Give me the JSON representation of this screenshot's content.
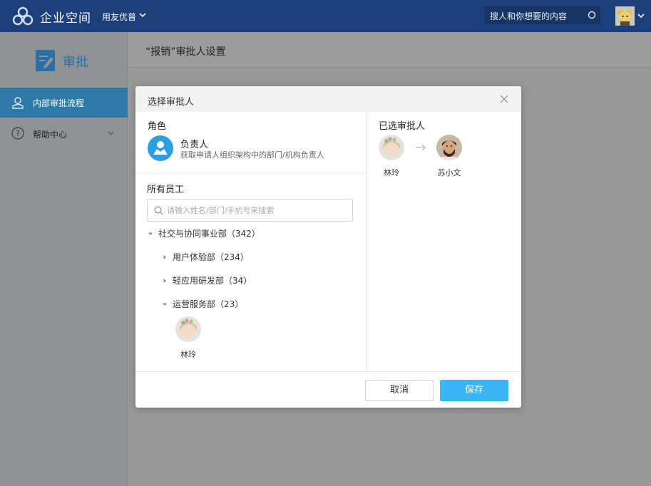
{
  "topbar": {
    "brand": "企业空间",
    "org": "用友优普",
    "search_placeholder": "搜人和你想要的内容",
    "bg_color": "#1b3f7a"
  },
  "sidebar": {
    "title": "审批",
    "items": [
      {
        "label": "内部审批流程",
        "icon": "user-icon",
        "active": true
      },
      {
        "label": "帮助中心",
        "icon": "help-icon",
        "active": false
      }
    ]
  },
  "main": {
    "title": "“报销”审批人设置"
  },
  "modal": {
    "title": "选择审批人",
    "role_section": "角色",
    "role": {
      "name": "负责人",
      "desc": "获取申请人组织架构中的部门/机构负责人"
    },
    "employees_section": "所有员工",
    "search_placeholder": "请输入姓名/部门/手机号来搜索",
    "tree": [
      {
        "label": "社交与协同事业部（342）",
        "expanded": true,
        "level": 0
      },
      {
        "label": "用户体验部（234）",
        "expanded": false,
        "level": 1
      },
      {
        "label": "轻应用研发部（34）",
        "expanded": false,
        "level": 1
      },
      {
        "label": "运营服务部（23）",
        "expanded": true,
        "level": 1
      }
    ],
    "dept_member": {
      "name": "林玲"
    },
    "selected_section": "已选审批人",
    "selected": [
      {
        "name": "林玲"
      },
      {
        "name": "苏小文"
      }
    ],
    "cancel_label": "取消",
    "save_label": "保存",
    "accent_color": "#38b6f3"
  }
}
